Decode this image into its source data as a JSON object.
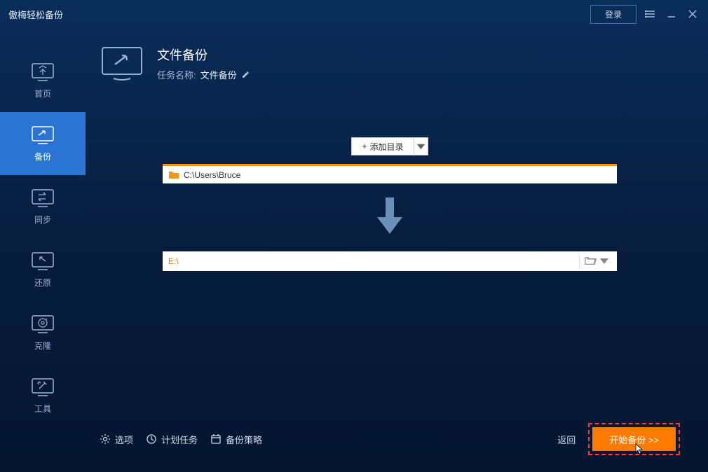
{
  "titlebar": {
    "app_title": "傲梅轻松备份",
    "login_label": "登录"
  },
  "sidebar": {
    "items": [
      {
        "label": "首页"
      },
      {
        "label": "备份"
      },
      {
        "label": "同步"
      },
      {
        "label": "还原"
      },
      {
        "label": "克隆"
      },
      {
        "label": "工具"
      }
    ]
  },
  "header": {
    "title": "文件备份",
    "task_label": "任务名称:",
    "task_value": "文件备份"
  },
  "content": {
    "add_dir_label": "添加目录",
    "source_path": "C:\\Users\\Bruce",
    "dest_path": "E:\\"
  },
  "footer": {
    "options": "选项",
    "schedule": "计划任务",
    "strategy": "备份策略",
    "back": "返回",
    "start": "开始备份 >>"
  },
  "colors": {
    "accent_orange": "#ff7b00",
    "highlight_red": "#f44336",
    "active_blue": "#2a74d4",
    "folder_orange": "#f39612"
  }
}
